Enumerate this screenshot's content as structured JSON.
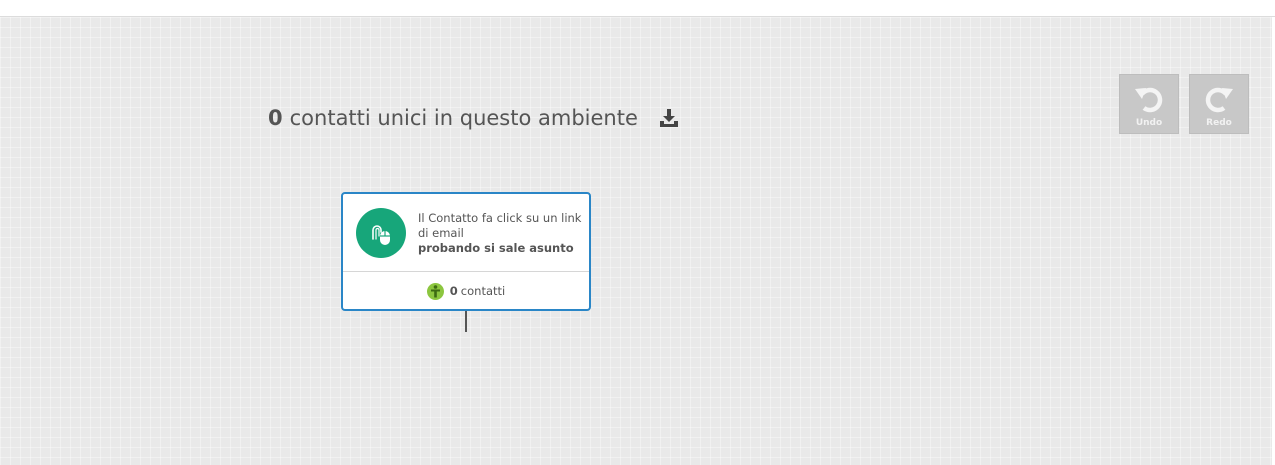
{
  "header": {
    "unique_count": "0",
    "unique_label": "contatti unici in questo ambiente",
    "download_icon": "download-icon"
  },
  "toolbar": {
    "undo_label": "Undo",
    "redo_label": "Redo",
    "undo_icon": "undo-icon",
    "redo_icon": "redo-icon"
  },
  "node": {
    "title": "Il Contatto fa click su un link di email",
    "subtitle": "probando si sale asunto",
    "icon": "mouse-click-icon",
    "contacts_count": "0",
    "contacts_label": "contatti",
    "person_icon": "person-icon"
  },
  "colors": {
    "node_border": "#2a86c7",
    "node_icon_bg": "#17a67a",
    "badge_bg": "#8cc63f",
    "canvas_bg": "#e9e9e9",
    "tool_button_bg": "#c8c8c8"
  }
}
